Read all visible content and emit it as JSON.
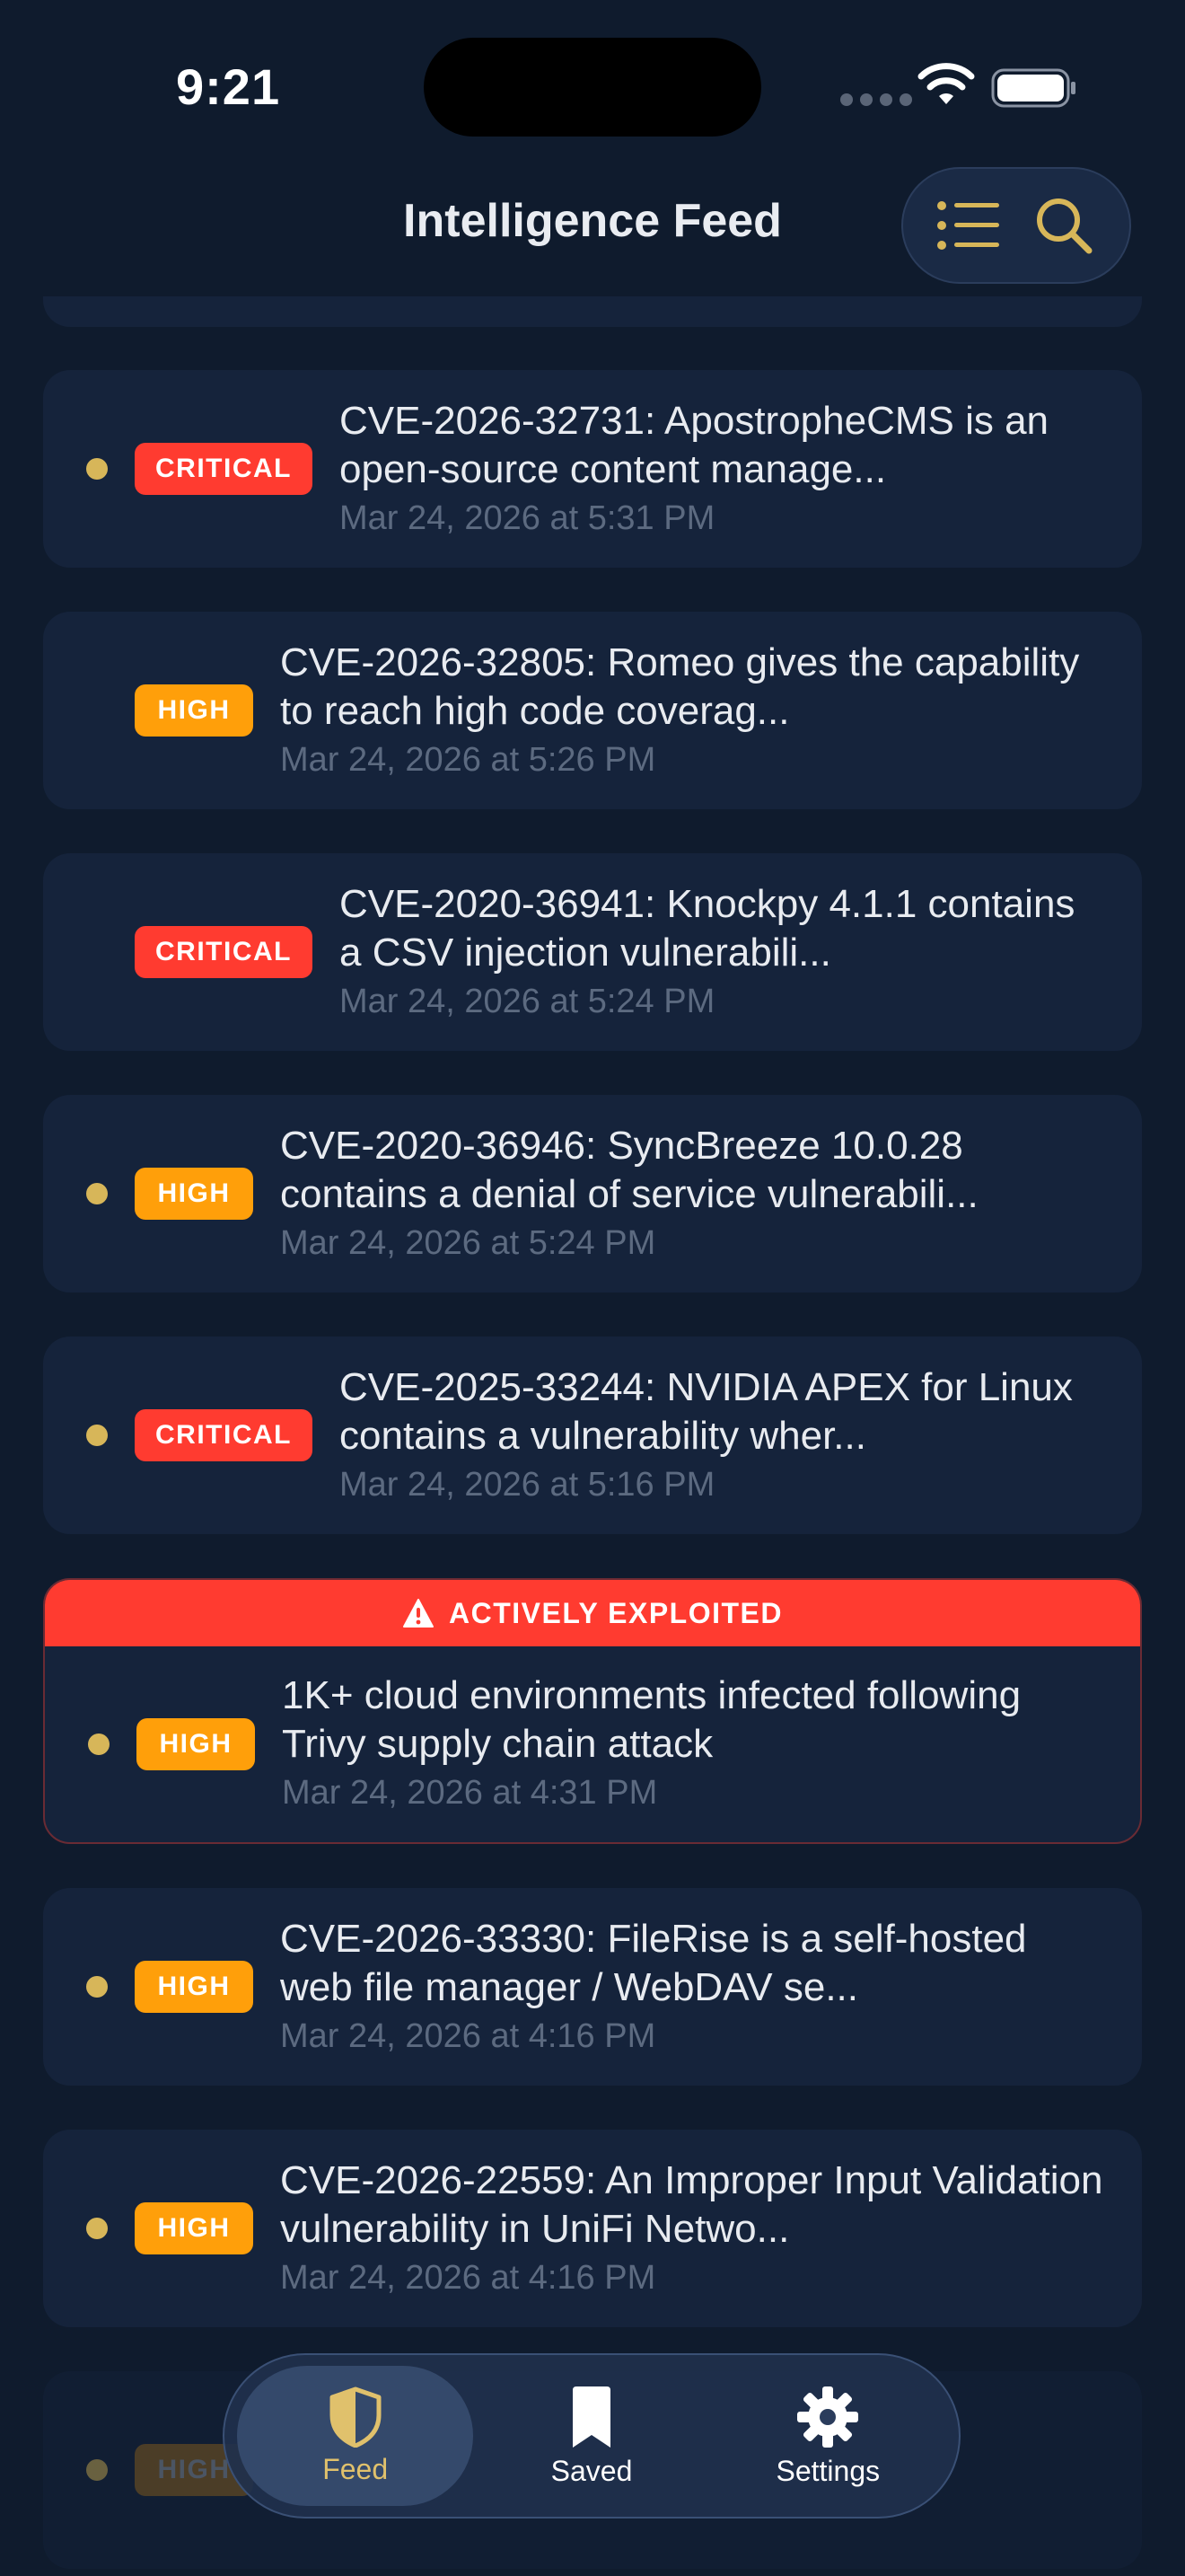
{
  "status_bar": {
    "time": "9:21"
  },
  "nav": {
    "title": "Intelligence Feed",
    "filter_icon": "list-icon",
    "search_icon": "search-icon"
  },
  "colors": {
    "background": "#0f1b2d",
    "card": "#15233b",
    "critical": "#ff3b30",
    "high": "#ff9f0a",
    "accent_gold": "#d7b659",
    "date_text": "#5c6a80"
  },
  "feed": {
    "items": [
      {
        "unread": true,
        "severity": "CRITICAL",
        "title": "CVE-2026-32731: ApostropheCMS is an open-source content manage...",
        "date": "Mar 24, 2026 at 5:31 PM"
      },
      {
        "unread": false,
        "severity": "HIGH",
        "title": "CVE-2026-32805: Romeo gives the capability to reach high code coverag...",
        "date": "Mar 24, 2026 at 5:26 PM"
      },
      {
        "unread": false,
        "severity": "CRITICAL",
        "title": "CVE-2020-36941: Knockpy 4.1.1 contains a CSV injection vulnerabili...",
        "date": "Mar 24, 2026 at 5:24 PM"
      },
      {
        "unread": true,
        "severity": "HIGH",
        "title": "CVE-2020-36946: SyncBreeze 10.0.28 contains a denial of service vulnerabili...",
        "date": "Mar 24, 2026 at 5:24 PM"
      },
      {
        "unread": true,
        "severity": "CRITICAL",
        "title": "CVE-2025-33244: NVIDIA APEX for Linux contains a vulnerability wher...",
        "date": "Mar 24, 2026 at 5:16 PM"
      },
      {
        "unread": true,
        "severity": "HIGH",
        "banner": "ACTIVELY EXPLOITED",
        "title": "1K+ cloud environments infected following Trivy supply chain attack",
        "date": "Mar 24, 2026 at 4:31 PM"
      },
      {
        "unread": true,
        "severity": "HIGH",
        "title": "CVE-2026-33330: FileRise is a self-hosted web file manager / WebDAV se...",
        "date": "Mar 24, 2026 at 4:16 PM"
      },
      {
        "unread": true,
        "severity": "HIGH",
        "title": "CVE-2026-22559: An Improper Input Validation vulnerability in UniFi Netwo...",
        "date": "Mar 24, 2026 at 4:16 PM"
      }
    ]
  },
  "tab_bar": {
    "tabs": [
      {
        "label": "Feed",
        "icon": "shield-icon",
        "active": true
      },
      {
        "label": "Saved",
        "icon": "bookmark-icon",
        "active": false
      },
      {
        "label": "Settings",
        "icon": "gear-icon",
        "active": false
      }
    ]
  }
}
